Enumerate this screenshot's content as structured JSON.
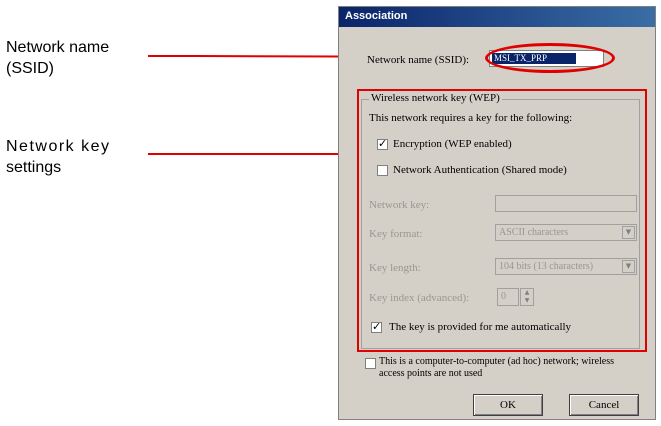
{
  "callouts": {
    "ssid_line1": "Network name",
    "ssid_line2": "(SSID)",
    "key_line1": "Network key",
    "key_line2": "settings"
  },
  "dialog": {
    "title": "Association",
    "ssid_label": "Network name (SSID):",
    "ssid_value": "MSI_TX_PRP",
    "group_title": "Wireless network key (WEP)",
    "group_desc": "This network requires a key for the following:",
    "encryption_label": "Encryption (WEP enabled)",
    "encryption_checked": true,
    "auth_label": "Network Authentication (Shared mode)",
    "auth_checked": false,
    "network_key_label": "Network key:",
    "network_key_value": "",
    "key_format_label": "Key format:",
    "key_format_value": "ASCII characters",
    "key_length_label": "Key length:",
    "key_length_value": "104 bits (13 characters)",
    "key_index_label": "Key index (advanced):",
    "key_index_value": "0",
    "auto_key_label": "The key is provided for me automatically",
    "auto_key_checked": true,
    "adhoc_label_line1": "This is a computer-to-computer (ad hoc) network; wireless",
    "adhoc_label_line2": "access points are not used",
    "adhoc_checked": false,
    "ok_label": "OK",
    "cancel_label": "Cancel"
  },
  "colors": {
    "annotation_red": "#e00000",
    "dialog_bg": "#d4d0c8",
    "titlebar": "#0a246a"
  }
}
